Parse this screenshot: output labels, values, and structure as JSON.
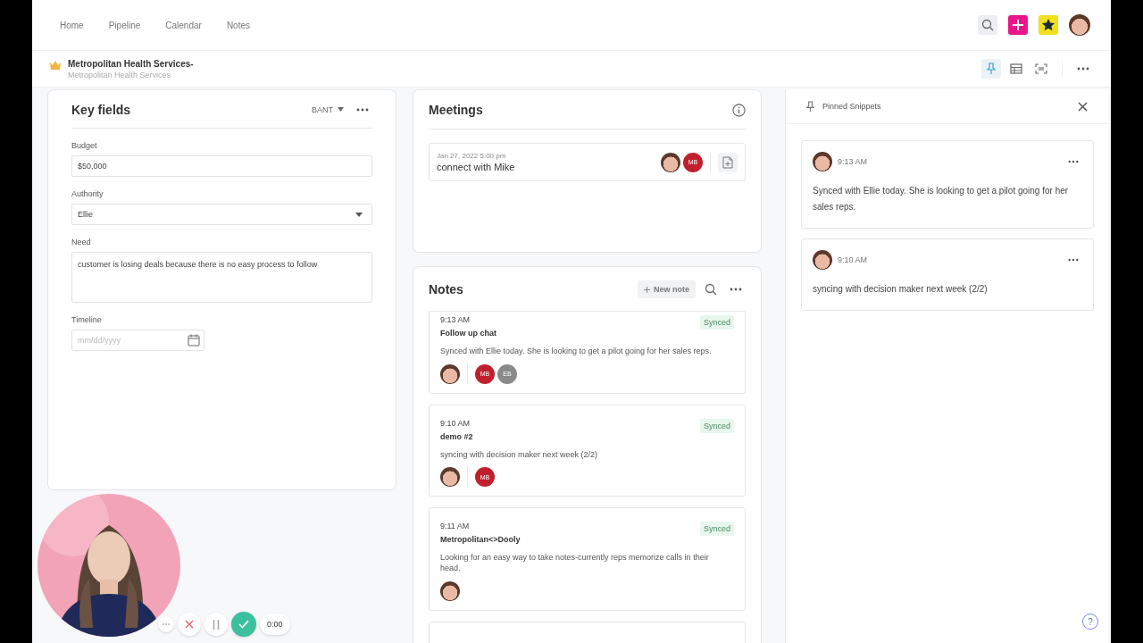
{
  "nav": {
    "items": [
      {
        "label": "Home"
      },
      {
        "label": "Pipeline"
      },
      {
        "label": "Calendar"
      },
      {
        "label": "Notes"
      }
    ]
  },
  "account": {
    "name": "Metropolitan Health Services-",
    "subtitle": "Metropolitan Health Services"
  },
  "view_buttons": [
    {
      "kind": "pin",
      "selected": true
    },
    {
      "kind": "table",
      "selected": false
    },
    {
      "kind": "scan",
      "selected": false
    }
  ],
  "key_fields": {
    "title": "Key fields",
    "template": "BANT",
    "fields": [
      {
        "kind": "text",
        "label": "Budget",
        "value": "$50,000"
      },
      {
        "kind": "select",
        "label": "Authority",
        "value": "Ellie"
      },
      {
        "kind": "textarea",
        "label": "Need",
        "value": "customer is losing deals because there is no easy process to follow"
      },
      {
        "kind": "date",
        "label": "Timeline",
        "placeholder": "mm/dd/yyyy"
      }
    ]
  },
  "meetings": {
    "title": "Meetings",
    "items": [
      {
        "date": "Jan 27, 2022 5:00 pm",
        "title": "connect with Mike",
        "participants": [
          {
            "kind": "avatar"
          },
          {
            "kind": "initials",
            "text": "MB",
            "color": "#c0202e"
          }
        ]
      }
    ]
  },
  "notes": {
    "title": "Notes",
    "new_note": "New note",
    "items": [
      {
        "time": "9:13 AM",
        "title": "Follow up chat",
        "body": "Synced with Ellie today. She is looking to get a pilot going for her sales reps.",
        "status": "Synced",
        "participants": [
          {
            "kind": "avatar"
          },
          {
            "kind": "initials",
            "text": "MB",
            "color": "#c0202e"
          },
          {
            "kind": "initials",
            "text": "EB",
            "color": "#8a8a8a"
          }
        ]
      },
      {
        "time": "9:10 AM",
        "title": "demo #2",
        "body": "syncing with decision maker next week (2/2)",
        "status": "Synced",
        "participants": [
          {
            "kind": "avatar"
          },
          {
            "kind": "initials",
            "text": "MB",
            "color": "#c0202e"
          }
        ]
      },
      {
        "time": "9:11 AM",
        "title": "Metropolitan<>Dooly",
        "body": "Looking for an easy way to take notes-currently reps memorize calls in their head.",
        "status": "Synced",
        "participants": [
          {
            "kind": "avatar"
          }
        ]
      }
    ]
  },
  "pinned": {
    "title": "Pinned Snippets",
    "items": [
      {
        "time": "9:13 AM",
        "text": "Synced with Ellie today. She is looking to get a pilot going for her sales reps."
      },
      {
        "time": "9:10 AM",
        "text": "syncing with decision maker next week (2/2)"
      }
    ]
  },
  "recorder": {
    "timer": "0:00"
  },
  "help": {
    "label": "?"
  }
}
